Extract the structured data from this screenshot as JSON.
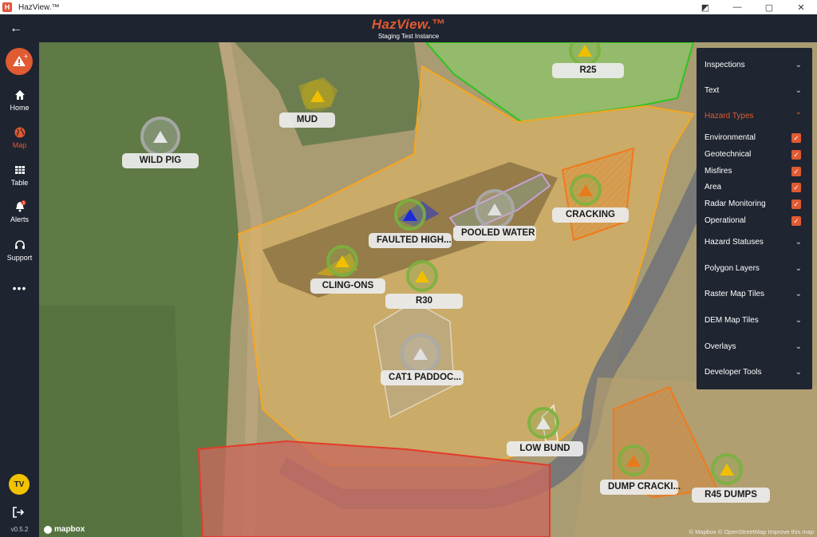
{
  "window": {
    "app_icon": "H",
    "title": "HazView.™",
    "controls": [
      "◩",
      "—",
      "▢",
      "✕"
    ]
  },
  "header": {
    "brand": "HazView.™",
    "subtitle": "Staging Test Instance",
    "back_icon": "←"
  },
  "nav": {
    "items": [
      {
        "label": "Home",
        "icon": "home-icon"
      },
      {
        "label": "Map",
        "icon": "globe-icon",
        "active": true
      },
      {
        "label": "Table",
        "icon": "table-icon"
      },
      {
        "label": "Alerts",
        "icon": "bell-icon",
        "badge": "1"
      },
      {
        "label": "Support",
        "icon": "headset-icon"
      }
    ],
    "more": "•••",
    "avatar": "TV",
    "version": "v0.5.2"
  },
  "map": {
    "labels": {
      "wild_pig": "WILD PIG",
      "mud": "MUD",
      "r25": "R25",
      "faulted": "FAULTED HIGH...",
      "pooled_water": "POOLED WATER",
      "cracking": "CRACKING",
      "cling_ons": "CLING-ONS",
      "r30": "R30",
      "cat1": "CAT1 PADDOC...",
      "low_bund": "LOW BUND",
      "dump_cracking": "DUMP CRACKI...",
      "r45_dumps": "R45 DUMPS"
    },
    "mapbox": "mapbox",
    "attribution": "© Mapbox  © OpenStreetMap  Improve this map"
  },
  "panel": {
    "sections": [
      {
        "label": "Inspections",
        "chevron": "⌄"
      },
      {
        "label": "Text",
        "chevron": "⌄"
      },
      {
        "label": "Hazard Types",
        "chevron": "⌃",
        "open": true
      },
      {
        "label": "Hazard Statuses",
        "chevron": "⌄"
      },
      {
        "label": "Polygon Layers",
        "chevron": "⌄"
      },
      {
        "label": "Raster Map Tiles",
        "chevron": "⌄"
      },
      {
        "label": "DEM Map Tiles",
        "chevron": "⌄"
      },
      {
        "label": "Overlays",
        "chevron": "⌄"
      },
      {
        "label": "Developer Tools",
        "chevron": "⌄"
      }
    ],
    "hazard_types": [
      {
        "label": "Environmental",
        "checked": true
      },
      {
        "label": "Geotechnical",
        "checked": true
      },
      {
        "label": "Misfires",
        "checked": true
      },
      {
        "label": "Area",
        "checked": true
      },
      {
        "label": "Radar Monitoring",
        "checked": true
      },
      {
        "label": "Operational",
        "checked": true
      }
    ],
    "check_mark": "✓"
  },
  "colors": {
    "accent": "#e05a32",
    "sidebar": "#1e2430",
    "zone_yellow": "#f5a623",
    "zone_green": "#2ec41f",
    "zone_red": "#e53a2a",
    "zone_orange": "#f07a1a"
  }
}
